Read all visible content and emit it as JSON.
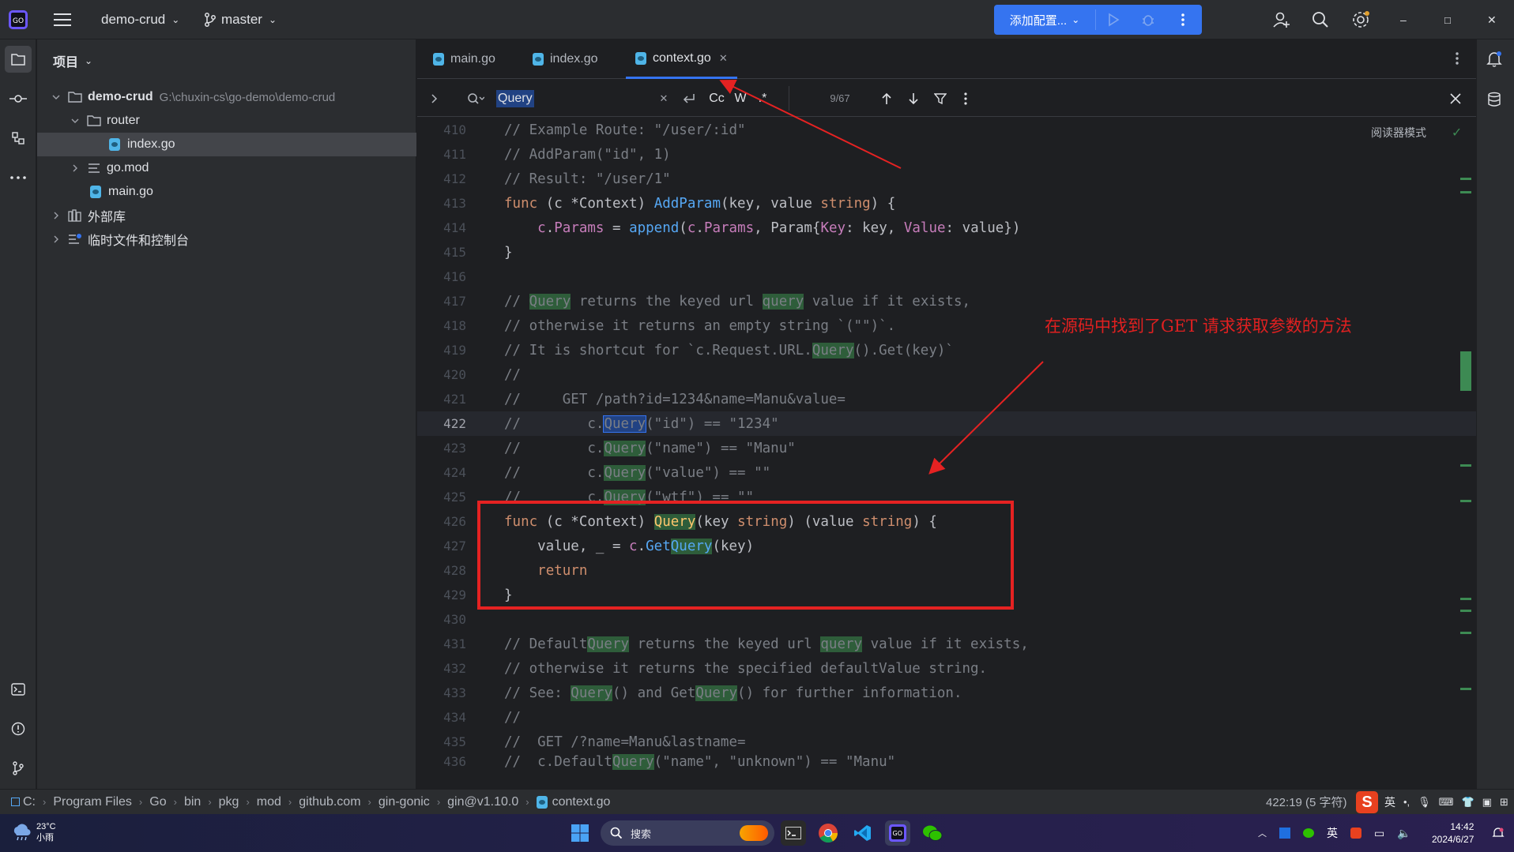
{
  "titlebar": {
    "project": "demo-crud",
    "branch": "master",
    "run_config": "添加配置...",
    "window_buttons": [
      "–",
      "□",
      "✕"
    ]
  },
  "project_panel": {
    "title": "项目",
    "tree": [
      {
        "label": "demo-crud",
        "path": "G:\\chuxin-cs\\go-demo\\demo-crud"
      },
      {
        "label": "router"
      },
      {
        "label": "index.go"
      },
      {
        "label": "go.mod"
      },
      {
        "label": "main.go"
      },
      {
        "label": "外部库"
      },
      {
        "label": "临时文件和控制台"
      }
    ]
  },
  "tabs": [
    {
      "label": "main.go"
    },
    {
      "label": "index.go"
    },
    {
      "label": "context.go"
    }
  ],
  "find": {
    "query": "Query",
    "case_label": "Cc",
    "word_label": "W",
    "regex_label": ".*",
    "count": "9/67"
  },
  "editor": {
    "reader_mode": "阅读器模式",
    "annotation": "在源码中找到了GET 请求获取参数的方法",
    "line_numbers": [
      "410",
      "411",
      "412",
      "413",
      "414",
      "415",
      "416",
      "417",
      "418",
      "419",
      "420",
      "421",
      "422",
      "423",
      "424",
      "425",
      "426",
      "427",
      "428",
      "429",
      "430",
      "431",
      "432",
      "433",
      "434",
      "435",
      "436"
    ]
  },
  "statusbar": {
    "breadcrumbs": [
      "C:",
      "Program Files",
      "Go",
      "bin",
      "pkg",
      "mod",
      "github.com",
      "gin-gonic",
      "gin@v1.10.0",
      "context.go"
    ],
    "position": "422:19 (5 字符)",
    "ime": "英"
  },
  "taskbar": {
    "weather_temp": "23°C",
    "weather_desc": "小雨",
    "search_placeholder": "搜索",
    "lang": "英",
    "time": "14:42",
    "date": "2024/6/27"
  }
}
